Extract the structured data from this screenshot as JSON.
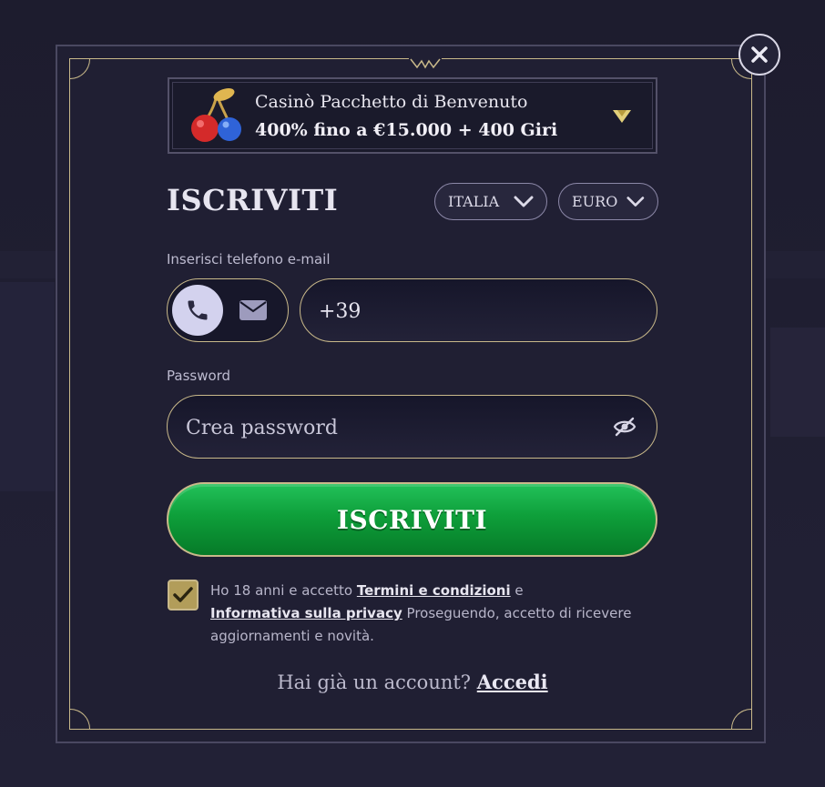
{
  "promo": {
    "title": "Casinò Pacchetto di Benvenuto",
    "offer": "400% fino a €15.000 + 400 Giri",
    "icon": "cherries-icon"
  },
  "form": {
    "heading": "ISCRIVITI",
    "country_value": "ITALIA",
    "currency_value": "EURO",
    "contact_label": "Inserisci telefono e-mail",
    "phone_value": "+39",
    "password_label": "Password",
    "password_placeholder": "Crea password",
    "submit_label": "ISCRIVITI"
  },
  "consent": {
    "checked": true,
    "text_1": "Ho 18 anni e accetto",
    "terms_link": "Termini e condizioni",
    "text_2": "e",
    "privacy_link": "Informativa sulla privacy",
    "text_3": "Proseguendo, accetto di ricevere aggiornamenti e novità."
  },
  "footer": {
    "question": "Hai già un account?",
    "login_link": "Accedi"
  },
  "colors": {
    "accent_gold": "#c9b98a",
    "submit_green": "#0e9f3a",
    "panel_bg": "#201f33"
  }
}
